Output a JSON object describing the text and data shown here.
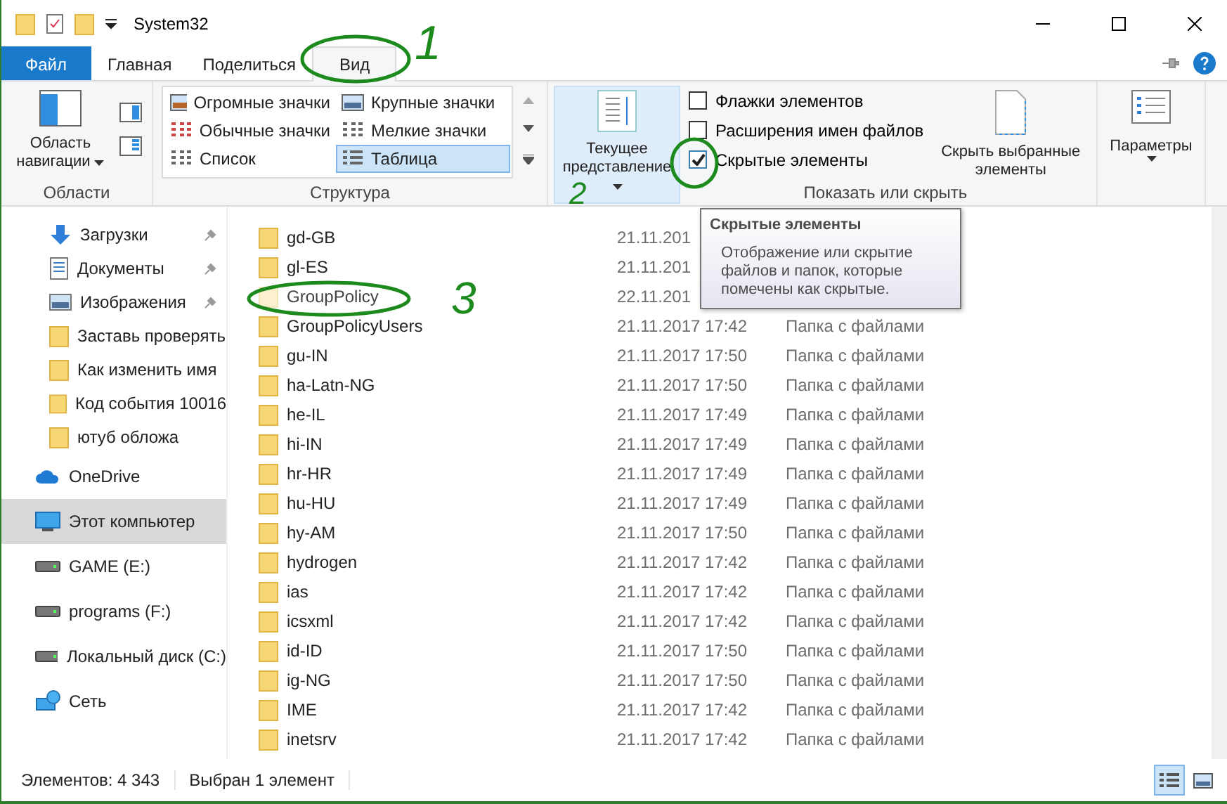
{
  "window": {
    "title": "System32"
  },
  "ribbon_tabs": [
    {
      "label": "Файл",
      "kind": "file",
      "selected": false
    },
    {
      "label": "Главная",
      "kind": "tab",
      "selected": false
    },
    {
      "label": "Поделиться",
      "kind": "tab",
      "selected": false
    },
    {
      "label": "Вид",
      "kind": "tab",
      "selected": true
    }
  ],
  "ribbon": {
    "areas": {
      "nav_button": "Область навигации",
      "group_label": "Области"
    },
    "layout": {
      "group_label": "Структура",
      "items": [
        {
          "label": "Огромные значки",
          "selected": false
        },
        {
          "label": "Крупные значки",
          "selected": false
        },
        {
          "label": "Обычные значки",
          "selected": false
        },
        {
          "label": "Мелкие значки",
          "selected": false
        },
        {
          "label": "Список",
          "selected": false
        },
        {
          "label": "Таблица",
          "selected": true
        }
      ]
    },
    "current_view": {
      "label": "Текущее представление"
    },
    "show_hide": {
      "group_label": "Показать или скрыть",
      "checkboxes": [
        {
          "label": "Флажки элементов",
          "checked": false
        },
        {
          "label": "Расширения имен файлов",
          "checked": false
        },
        {
          "label": "Скрытые элементы",
          "checked": true
        }
      ],
      "hide_selected": "Скрыть выбранные элементы"
    },
    "options": {
      "label": "Параметры"
    }
  },
  "sidebar": {
    "items": [
      {
        "label": "Загрузки",
        "kind": "download",
        "pinned": true,
        "selected": false
      },
      {
        "label": "Документы",
        "kind": "documents",
        "pinned": true,
        "selected": false
      },
      {
        "label": "Изображения",
        "kind": "pictures",
        "pinned": true,
        "selected": false
      },
      {
        "label": "Заставь проверять",
        "kind": "folder",
        "pinned": false,
        "selected": false
      },
      {
        "label": "Как изменить имя",
        "kind": "folder",
        "pinned": false,
        "selected": false
      },
      {
        "label": "Код события 10016",
        "kind": "folder",
        "pinned": false,
        "selected": false
      },
      {
        "label": "ютуб обложа",
        "kind": "folder",
        "pinned": false,
        "selected": false
      },
      {
        "label": "OneDrive",
        "kind": "onedrive",
        "pinned": false,
        "selected": false
      },
      {
        "label": "Этот компьютер",
        "kind": "pc",
        "pinned": false,
        "selected": true
      },
      {
        "label": "GAME (E:)",
        "kind": "drive",
        "pinned": false,
        "selected": false
      },
      {
        "label": "programs (F:)",
        "kind": "drive",
        "pinned": false,
        "selected": false
      },
      {
        "label": "Локальный диск (C:)",
        "kind": "drive",
        "pinned": false,
        "selected": false
      },
      {
        "label": "Сеть",
        "kind": "network",
        "pinned": false,
        "selected": false
      }
    ]
  },
  "files": [
    {
      "name": "gd-GB",
      "date": "21.11.201",
      "hidden": false
    },
    {
      "name": "gl-ES",
      "date": "21.11.201",
      "hidden": false
    },
    {
      "name": "GroupPolicy",
      "date": "22.11.201",
      "hidden": true
    },
    {
      "name": "GroupPolicyUsers",
      "date": "21.11.2017 17:42",
      "type": "Папка с файлами",
      "hidden": false
    },
    {
      "name": "gu-IN",
      "date": "21.11.2017 17:50",
      "type": "Папка с файлами",
      "hidden": false
    },
    {
      "name": "ha-Latn-NG",
      "date": "21.11.2017 17:50",
      "type": "Папка с файлами",
      "hidden": false
    },
    {
      "name": "he-IL",
      "date": "21.11.2017 17:49",
      "type": "Папка с файлами",
      "hidden": false
    },
    {
      "name": "hi-IN",
      "date": "21.11.2017 17:49",
      "type": "Папка с файлами",
      "hidden": false
    },
    {
      "name": "hr-HR",
      "date": "21.11.2017 17:49",
      "type": "Папка с файлами",
      "hidden": false
    },
    {
      "name": "hu-HU",
      "date": "21.11.2017 17:49",
      "type": "Папка с файлами",
      "hidden": false
    },
    {
      "name": "hy-AM",
      "date": "21.11.2017 17:50",
      "type": "Папка с файлами",
      "hidden": false
    },
    {
      "name": "hydrogen",
      "date": "21.11.2017 17:42",
      "type": "Папка с файлами",
      "hidden": false
    },
    {
      "name": "ias",
      "date": "21.11.2017 17:42",
      "type": "Папка с файлами",
      "hidden": false
    },
    {
      "name": "icsxml",
      "date": "21.11.2017 17:42",
      "type": "Папка с файлами",
      "hidden": false
    },
    {
      "name": "id-ID",
      "date": "21.11.2017 17:50",
      "type": "Папка с файлами",
      "hidden": false
    },
    {
      "name": "ig-NG",
      "date": "21.11.2017 17:50",
      "type": "Папка с файлами",
      "hidden": false
    },
    {
      "name": "IME",
      "date": "21.11.2017 17:42",
      "type": "Папка с файлами",
      "hidden": false
    },
    {
      "name": "inetsrv",
      "date": "21.11.2017 17:42",
      "type": "Папка с файлами",
      "hidden": false
    }
  ],
  "tooltip": {
    "title": "Скрытые элементы",
    "text": "Отображение или скрытие файлов и папок, которые помечены как скрытые."
  },
  "status_bar": {
    "count": "Элементов: 4 343",
    "selection": "Выбран 1 элемент",
    "views": [
      {
        "kind": "details",
        "selected": true
      },
      {
        "kind": "thumbnails",
        "selected": false
      }
    ]
  },
  "annotations": [
    {
      "number": "1"
    },
    {
      "number": "2"
    },
    {
      "number": "3"
    }
  ]
}
